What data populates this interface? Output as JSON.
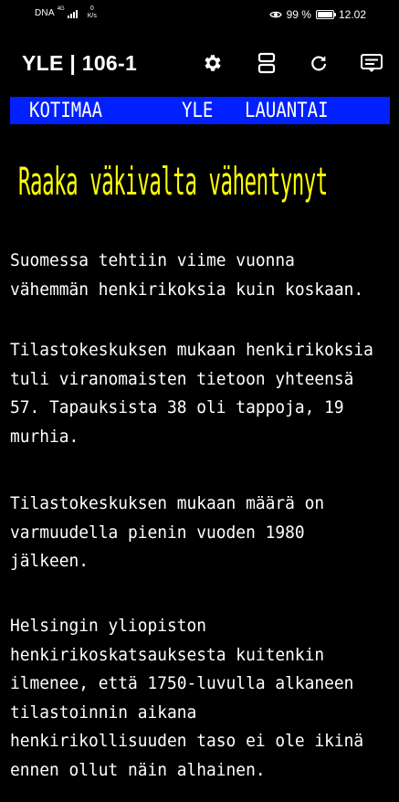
{
  "status_bar": {
    "carrier": "DNA",
    "network": "4G",
    "speed_value": "0",
    "speed_unit": "K/s",
    "battery": "99 %",
    "time": "12.02",
    "battery_level_pct": 99
  },
  "app_bar": {
    "title": "YLE | 106-1",
    "icons": [
      "gear-icon",
      "split-view-icon",
      "refresh-icon",
      "subtitles-icon"
    ]
  },
  "page": {
    "header": {
      "section": "KOTIMAA",
      "source": "YLE",
      "day": "LAUANTAI"
    },
    "headline": "Raaka väkivalta vähentynyt",
    "paragraphs": [
      "Suomessa tehtiin viime vuonna\nvähemmän henkirikoksia kuin koskaan.",
      "Tilastokeskuksen mukaan henkirikoksia\ntuli viranomaisten tietoon yhteensä\n57. Tapauksista 38 oli tappoja, 19\nmurhia.",
      "Tilastokeskuksen mukaan määrä on\nvarmuudella pienin vuoden 1980\njälkeen.",
      "Helsingin yliopiston\nhenkirikoskatsauksesta kuitenkin\nilmenee, että 1750-luvulla alkaneen\ntilastoinnin aikana\nhenkirikollisuuden taso ei ole ikinä\nennen ollut näin alhainen."
    ]
  },
  "colors": {
    "background": "#000000",
    "header_bar": "#0020ff",
    "headline": "#ffff00",
    "text": "#ffffff"
  }
}
